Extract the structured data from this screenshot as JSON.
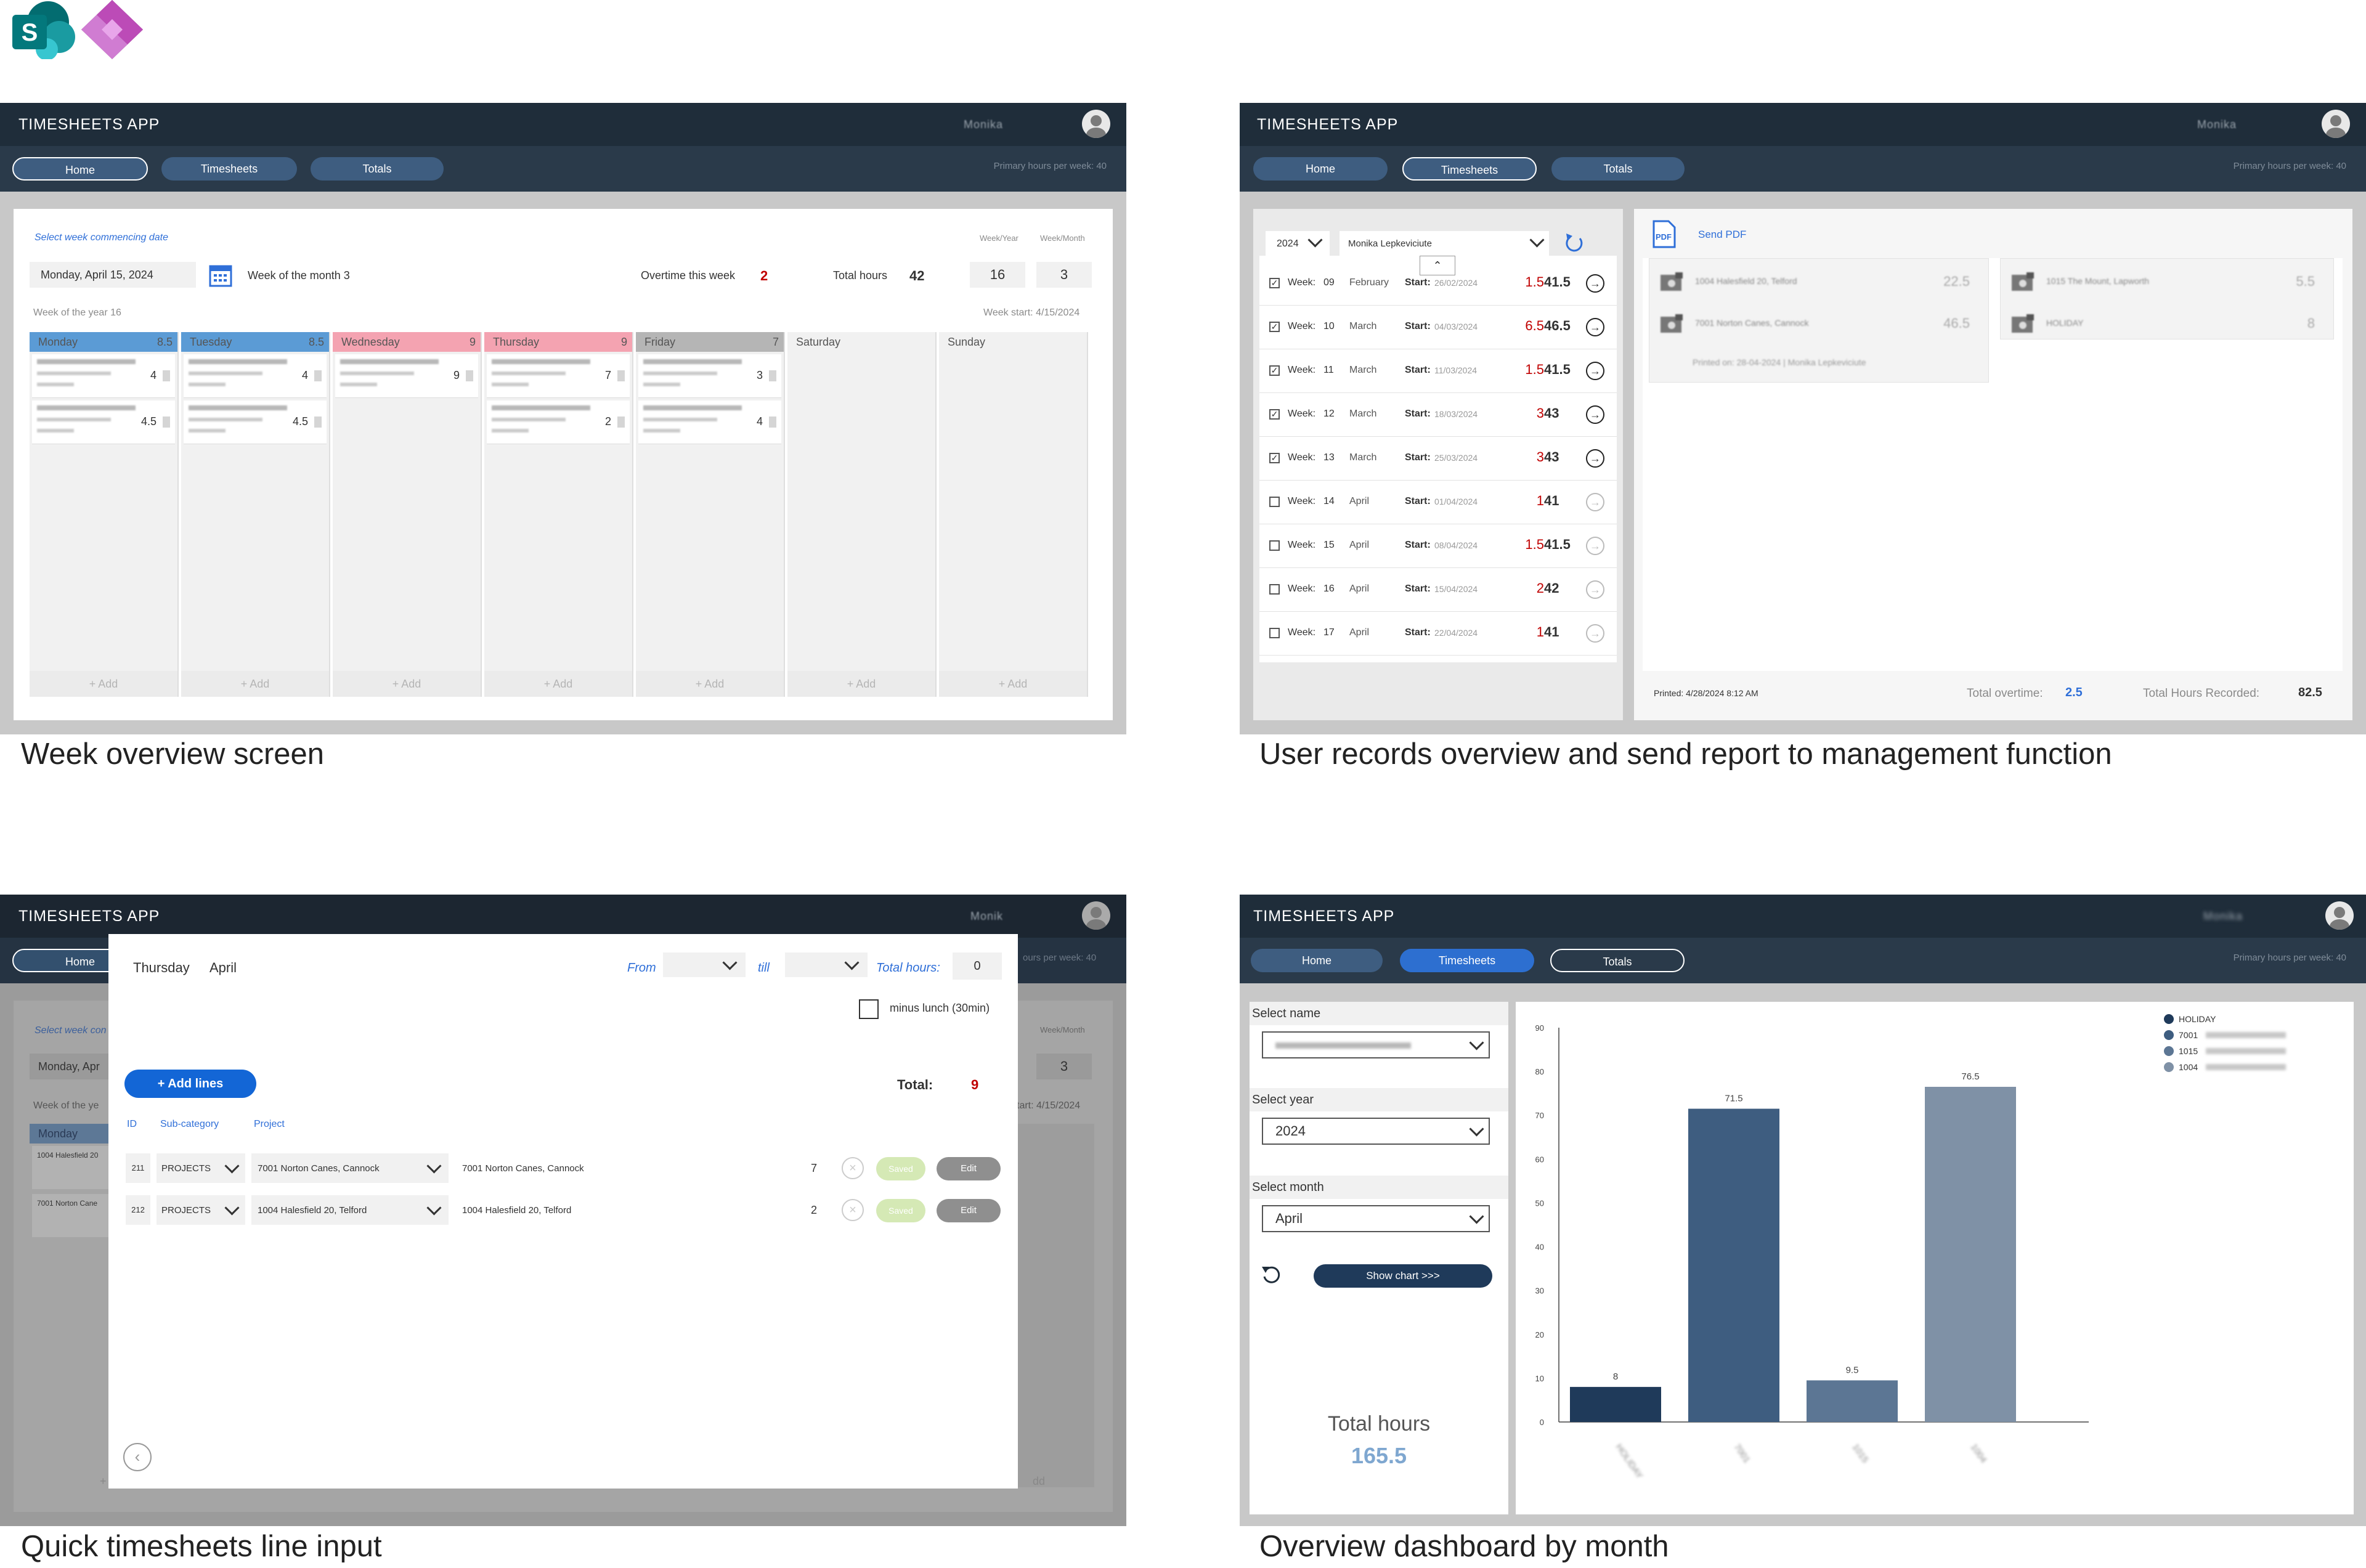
{
  "header": {
    "sharepoint_icon": "sharepoint-logo-icon",
    "powerapps_icon": "power-apps-logo-icon",
    "sharepoint_letter": "S"
  },
  "app": {
    "title": "TIMESHEETS APP",
    "primary_hours": "Primary hours per week: 40",
    "nav": [
      "Home",
      "Timesheets",
      "Totals"
    ]
  },
  "captions": {
    "week": "Week overview screen",
    "records": "User records overview and send report to management function",
    "quick": "Quick timesheets line input",
    "dashboard": "Overview dashboard by month"
  },
  "week": {
    "user": "Monika",
    "select_label": "Select week commencing date",
    "date_value": "Monday, April 15, 2024",
    "week_of_month": "Week of the month 3",
    "overtime_label": "Overtime this week",
    "overtime_value": "2",
    "total_label": "Total hours",
    "total_value": "42",
    "week_year_label": "Week/Year",
    "week_month_label": "Week/Month",
    "week_year_value": "16",
    "week_month_value": "3",
    "week_of_year": "Week of the year 16",
    "week_start": "Week start: 4/15/2024",
    "add_label": "+ Add",
    "days": [
      {
        "name": "Monday",
        "hours": "8.5",
        "color": "#5b9bd5",
        "entries": [
          "4",
          "4.5"
        ]
      },
      {
        "name": "Tuesday",
        "hours": "8.5",
        "color": "#5b9bd5",
        "entries": [
          "4",
          "4.5"
        ]
      },
      {
        "name": "Wednesday",
        "hours": "9",
        "color": "#f4a3b1",
        "entries": [
          "9"
        ]
      },
      {
        "name": "Thursday",
        "hours": "9",
        "color": "#f4a3b1",
        "entries": [
          "7",
          "2"
        ]
      },
      {
        "name": "Friday",
        "hours": "7",
        "color": "#b5b5b5",
        "entries": [
          "3",
          "4"
        ]
      },
      {
        "name": "Saturday",
        "hours": "",
        "color": "#f1f1f1",
        "entries": []
      },
      {
        "name": "Sunday",
        "hours": "",
        "color": "#f1f1f1",
        "entries": []
      }
    ]
  },
  "records": {
    "year": "2024",
    "person": "Monika Lepkeviciute",
    "send_pdf": "Send PDF",
    "pdf_icon": "pdf-file-icon",
    "week_label": "Week:",
    "start_label": "Start:",
    "rows": [
      {
        "week": "09",
        "month": "February",
        "start": "26/02/2024",
        "ot": "1.5",
        "total": "41.5",
        "checked": true
      },
      {
        "week": "10",
        "month": "March",
        "start": "04/03/2024",
        "ot": "6.5",
        "total": "46.5",
        "checked": true
      },
      {
        "week": "11",
        "month": "March",
        "start": "11/03/2024",
        "ot": "1.5",
        "total": "41.5",
        "checked": true
      },
      {
        "week": "12",
        "month": "March",
        "start": "18/03/2024",
        "ot": "3",
        "total": "43",
        "checked": true
      },
      {
        "week": "13",
        "month": "March",
        "start": "25/03/2024",
        "ot": "3",
        "total": "43",
        "checked": true
      },
      {
        "week": "14",
        "month": "April",
        "start": "01/04/2024",
        "ot": "1",
        "total": "41",
        "checked": false
      },
      {
        "week": "15",
        "month": "April",
        "start": "08/04/2024",
        "ot": "1.5",
        "total": "41.5",
        "checked": false
      },
      {
        "week": "16",
        "month": "April",
        "start": "15/04/2024",
        "ot": "2",
        "total": "42",
        "checked": false
      },
      {
        "week": "17",
        "month": "April",
        "start": "22/04/2024",
        "ot": "1",
        "total": "41",
        "checked": false
      }
    ],
    "report_items_left": [
      {
        "name": "1004 Halesfield 20, Telford",
        "value": "22.5"
      },
      {
        "name": "7001 Norton Canes, Cannock",
        "value": "46.5"
      }
    ],
    "report_items_right": [
      {
        "name": "1015 The Mount, Lapworth",
        "value": "5.5"
      },
      {
        "name": "HOLIDAY",
        "value": "8"
      }
    ],
    "printed_on": "Printed on: 28-04-2024 | Monika Lepkeviciute",
    "printed": "Printed: 4/28/2024 8:12 AM",
    "total_overtime_label": "Total overtime:",
    "total_overtime_value": "2.5",
    "total_hours_label": "Total Hours Recorded:",
    "total_hours_value": "82.5"
  },
  "quick": {
    "user": "Monik",
    "day": "Thursday",
    "month": "April",
    "from_label": "From",
    "till_label": "till",
    "total_hours_label": "Total hours:",
    "total_hours_value": "0",
    "minus_lunch": "minus lunch (30min)",
    "add_lines": "+ Add lines",
    "total_label": "Total:",
    "total_value": "9",
    "col_id": "ID",
    "col_sub": "Sub-category",
    "col_project": "Project",
    "saved_label": "Saved",
    "edit_label": "Edit",
    "lines": [
      {
        "id": "211",
        "sub": "PROJECTS",
        "project": "7001 Norton Canes, Cannock",
        "desc": "7001 Norton Canes, Cannock",
        "hours": "7"
      },
      {
        "id": "212",
        "sub": "PROJECTS",
        "project": "1004 Halesfield 20, Telford",
        "desc": "1004 Halesfield 20, Telford",
        "hours": "2"
      }
    ],
    "bg_select": "Select week con",
    "bg_date": "Monday, Apr",
    "bg_week_year": "Week of the ye",
    "bg_monday": "Monday",
    "bg_entry1": "1004 Halesfield 20",
    "bg_entry2": "7001 Norton Cane",
    "bg_hours_per_week": "ours per week: 40",
    "bg_week_month": "Week/Month",
    "bg_value3": "3",
    "bg_week_start": "tart: 4/15/2024",
    "bg_add": "+ A",
    "bg_add2": "dd"
  },
  "dashboard": {
    "select_name": "Select name",
    "select_year": "Select year",
    "year_value": "2024",
    "select_month": "Select month",
    "month_value": "April",
    "show_chart": "Show chart >>>",
    "total_hours_label": "Total hours",
    "total_hours_value": "165.5",
    "refresh_icon": "refresh-icon"
  },
  "chart_data": {
    "type": "bar",
    "categories": [
      "HOLIDAY",
      "7001",
      "1015",
      "1004"
    ],
    "values": [
      8,
      71.5,
      9.5,
      76.5
    ],
    "colors": [
      "#1f3a5a",
      "#3e5d80",
      "#5c7694",
      "#7f91a6"
    ],
    "ylim": [
      0,
      90
    ],
    "yticks": [
      0,
      10,
      20,
      30,
      40,
      50,
      60,
      70,
      80,
      90
    ],
    "legend": [
      "HOLIDAY",
      "7001",
      "1015",
      "1004"
    ],
    "legend_position": "top-right"
  }
}
